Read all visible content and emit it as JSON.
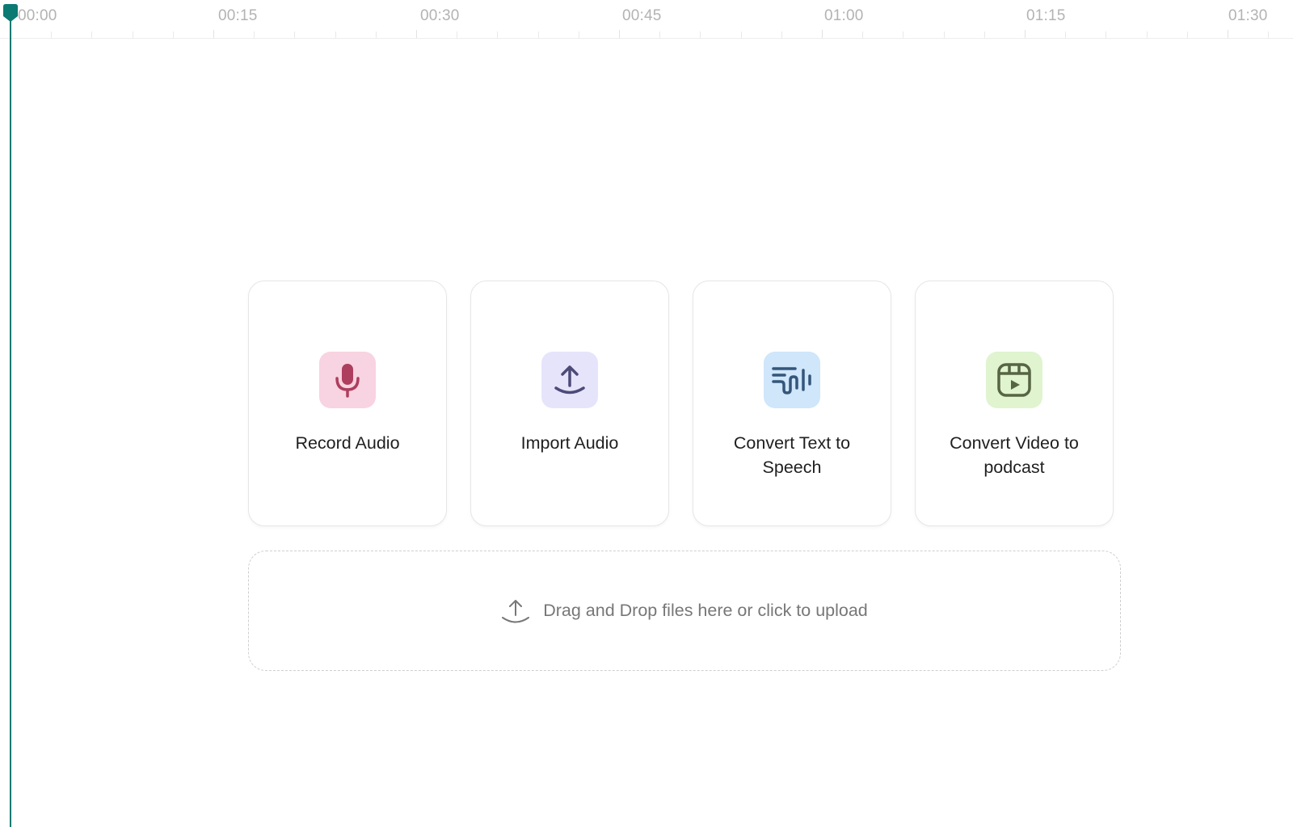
{
  "timeline": {
    "tick_labels": [
      "00:00",
      "00:15",
      "00:30",
      "00:45",
      "01:00",
      "01:15",
      "01:30"
    ],
    "playhead_time": "00:00",
    "accent_color": "#0b7a72"
  },
  "cards": [
    {
      "label": "Record Audio",
      "icon": "microphone-icon",
      "bg": "#f8d3e1",
      "fg": "#ad3e5e"
    },
    {
      "label": "Import Audio",
      "icon": "upload-icon",
      "bg": "#e6e4fb",
      "fg": "#4d4a78"
    },
    {
      "label": "Convert Text to Speech",
      "icon": "text-to-speech-icon",
      "bg": "#cfe6fb",
      "fg": "#35567a"
    },
    {
      "label": "Convert Video to podcast",
      "icon": "video-reel-icon",
      "bg": "#dff4cf",
      "fg": "#566544"
    }
  ],
  "dropzone": {
    "text": "Drag and Drop files here or click to upload",
    "icon": "upload-icon"
  }
}
